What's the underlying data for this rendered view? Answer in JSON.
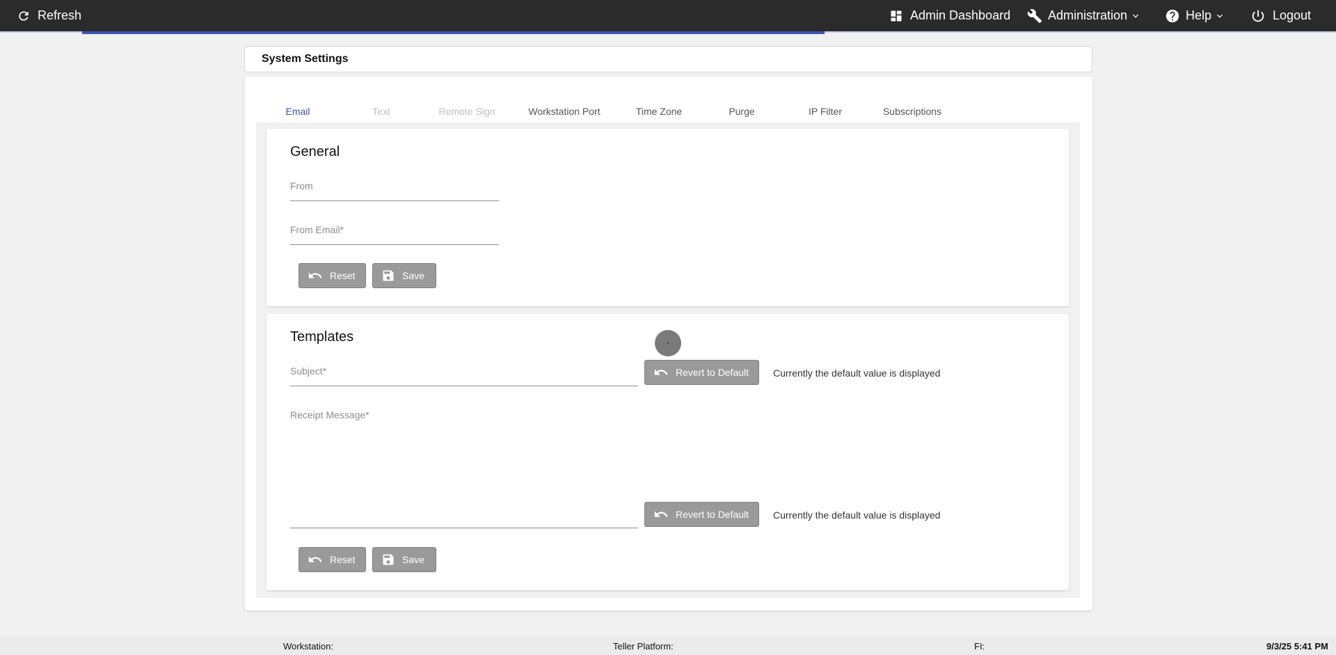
{
  "topbar": {
    "refresh_label": "Refresh",
    "admin_dashboard_label": "Admin Dashboard",
    "administration_label": "Administration",
    "help_label": "Help",
    "logout_label": "Logout",
    "progress": 0.5
  },
  "page": {
    "title": "System Settings"
  },
  "tabs": [
    {
      "label": "Email",
      "state": "active"
    },
    {
      "label": "Text",
      "state": "disabled"
    },
    {
      "label": "Remote Sign",
      "state": "disabled"
    },
    {
      "label": "Workstation Port",
      "state": "enabled"
    },
    {
      "label": "Time Zone",
      "state": "enabled"
    },
    {
      "label": "Purge",
      "state": "enabled"
    },
    {
      "label": "IP Filter",
      "state": "enabled"
    },
    {
      "label": "Subscriptions",
      "state": "enabled"
    }
  ],
  "general": {
    "title": "General",
    "from_label": "From",
    "from_value": "",
    "from_email_label": "From Email*",
    "from_email_value": "",
    "reset_label": "Reset",
    "save_label": "Save"
  },
  "templates": {
    "title": "Templates",
    "subject_label": "Subject*",
    "subject_value": "",
    "subject_revert_label": "Revert to Default",
    "subject_note": "Currently the default value is displayed",
    "receipt_label": "Receipt Message*",
    "receipt_value": "",
    "receipt_revert_label": "Revert to Default",
    "receipt_note": "Currently the default value is displayed",
    "reset_label": "Reset",
    "save_label": "Save"
  },
  "footer": {
    "workstation": "Workstation:",
    "teller_platform": "Teller Platform:",
    "fi": "FI:",
    "datetime": "9/3/25 5:41 PM"
  },
  "colors": {
    "topbar": "#2b2b2b",
    "accent": "#3f51b5",
    "button": "#9a9a9a",
    "background": "#f1f1f1"
  }
}
